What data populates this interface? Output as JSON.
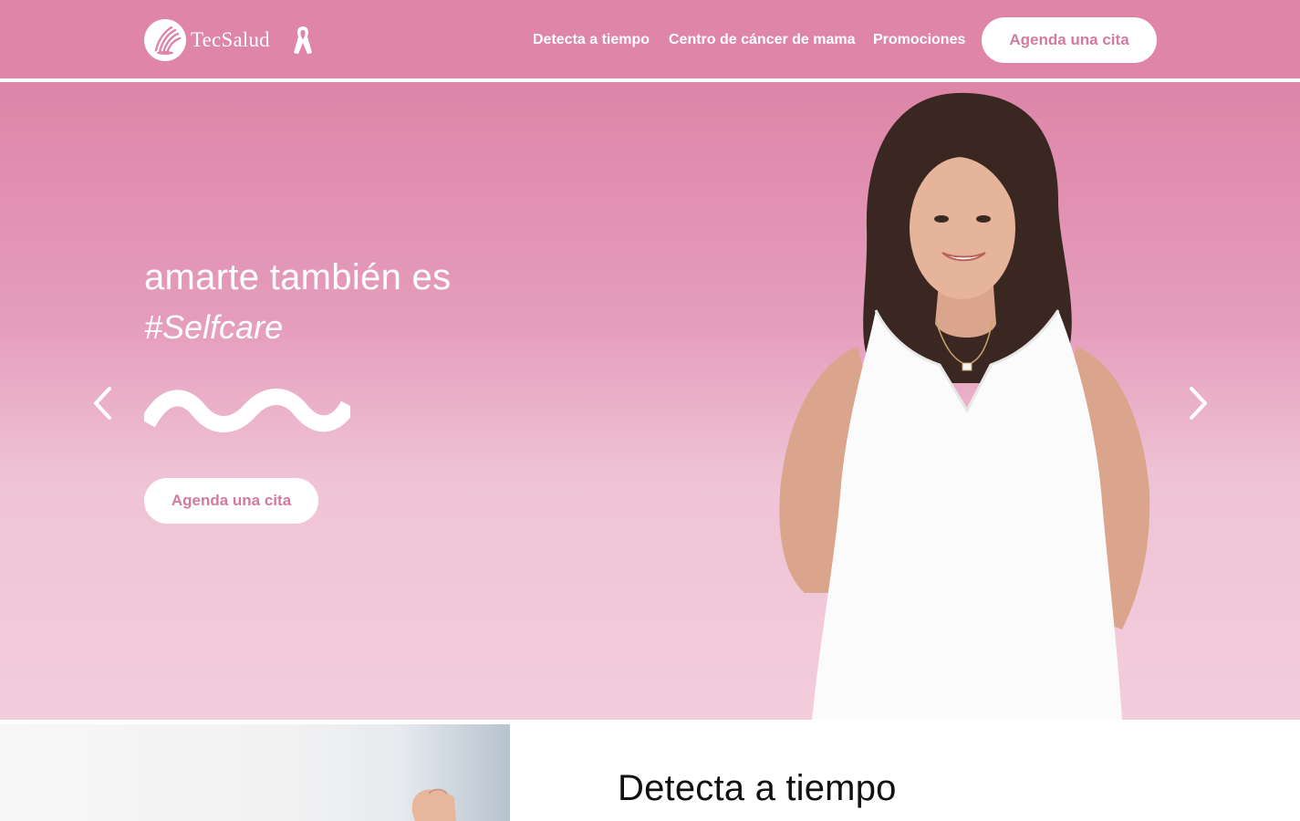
{
  "header": {
    "brand": "TecSalud",
    "nav": [
      "Detecta a tiempo",
      "Centro de cáncer de mama",
      "Promociones"
    ],
    "cta_label": "Agenda una cita",
    "background_color": "#de85a8"
  },
  "hero": {
    "title": "amarte también es",
    "subtitle": "#Selfcare",
    "cta_label": "Agenda una cita",
    "accent_color": "#d37aa0"
  },
  "section": {
    "title": "Detecta a tiempo"
  },
  "icons": [
    "tecsalud-logo-icon",
    "pink-ribbon-icon",
    "chevron-left-icon",
    "chevron-right-icon",
    "wave-icon"
  ]
}
